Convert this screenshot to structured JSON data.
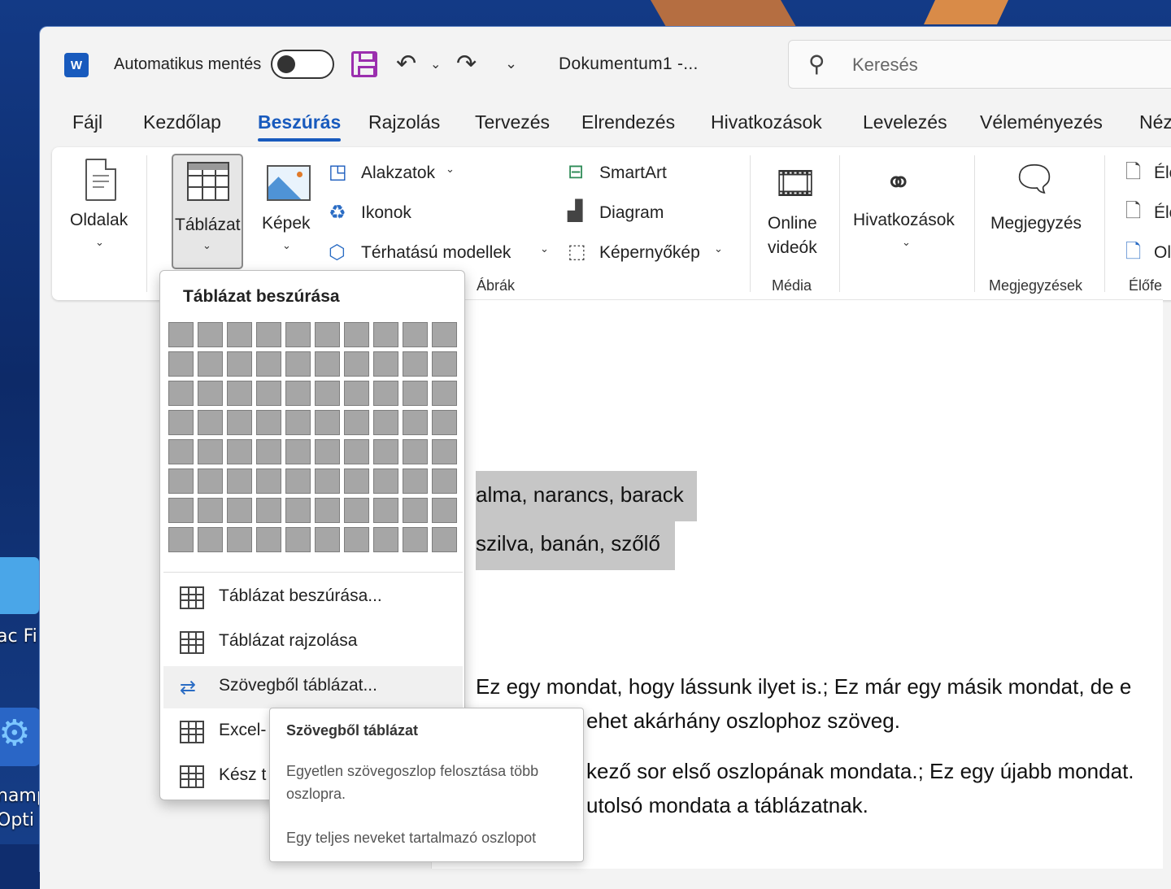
{
  "titlebar": {
    "autosave_label": "Automatikus mentés",
    "doc_title": "Dokumentum1  -...",
    "search_placeholder": "Keresés"
  },
  "tabs": [
    "Fájl",
    "Kezdőlap",
    "Beszúrás",
    "Rajzolás",
    "Tervezés",
    "Elrendezés",
    "Hivatkozások",
    "Levelezés",
    "Véleményezés",
    "Néz"
  ],
  "active_tab": "Beszúrás",
  "ribbon": {
    "oldalak": "Oldalak",
    "tablazat": "Táblázat",
    "kepek": "Képek",
    "alakzatok": "Alakzatok",
    "ikonok": "Ikonok",
    "terhatasu": "Térhatású modellek",
    "smartart": "SmartArt",
    "diagram": "Diagram",
    "kepernyokep": "Képernyőkép",
    "abrak_group": "Ábrák",
    "online_1": "Online",
    "online_2": "videók",
    "media_group": "Média",
    "hivatkozasok": "Hivatkozások",
    "megjegyzes": "Megjegyzés",
    "megjegyzesek_group": "Megjegyzések",
    "el1": "Élő",
    "el2": "Élő",
    "ol": "Ol",
    "elofe_group": "Élőfe"
  },
  "dropdown": {
    "title": "Táblázat beszúrása",
    "grid_cols": 10,
    "grid_rows": 8,
    "items": [
      {
        "label": "Táblázat beszúrása..."
      },
      {
        "label": "Táblázat rajzolása"
      },
      {
        "label": "Szövegből táblázat..."
      },
      {
        "label": "Excel-"
      },
      {
        "label": "Kész t"
      }
    ]
  },
  "tooltip": {
    "title": "Szövegből táblázat",
    "body": "Egyetlen szövegoszlop felosztása több oszlopra.",
    "body2": "Egy teljes neveket tartalmazó oszlopot"
  },
  "document": {
    "line1": "alma, narancs, barack",
    "line2": "szilva, banán, szőlő",
    "line3": "Ez egy mondat, hogy lássunk ilyet is.; Ez már egy másik mondat, de e",
    "line4": "ehet akárhány oszlophoz szöveg.",
    "line5": "kező sor első oszlopának mondata.; Ez egy újabb mondat.",
    "line6": "utolsó mondata a táblázatnak."
  },
  "desktop": {
    "label1": "ac Fi",
    "label2": "namp",
    "label3": "Opti"
  },
  "colors": {
    "accent": "#185abd",
    "save_icon": "#9b2fae",
    "selection": "#c6c6c6"
  }
}
